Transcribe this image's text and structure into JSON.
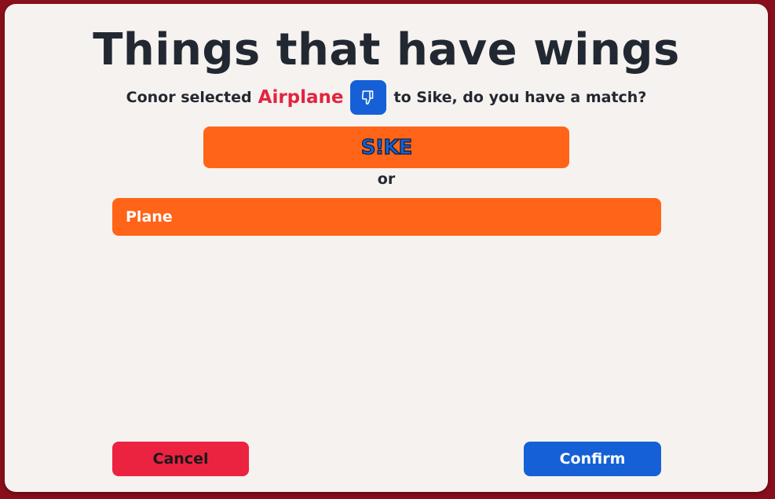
{
  "dialog": {
    "title": "Things that have wings",
    "subtitle": {
      "prefix": "Conor selected",
      "answer": "Airplane",
      "icon": "thumbs-down-icon",
      "suffix": "to Sike, do you have a match?"
    },
    "sike_button": {
      "label": "S!KE"
    },
    "or_label": "or",
    "answers": [
      {
        "label": "Plane"
      }
    ],
    "cancel_label": "Cancel",
    "confirm_label": "Confirm"
  },
  "colors": {
    "backdrop": "#8a0f1c",
    "panel": "#f6f2ef",
    "text": "#222831",
    "highlight": "#e3243f",
    "orange": "#ff6418",
    "blue": "#1560d6",
    "red": "#ec2241"
  }
}
